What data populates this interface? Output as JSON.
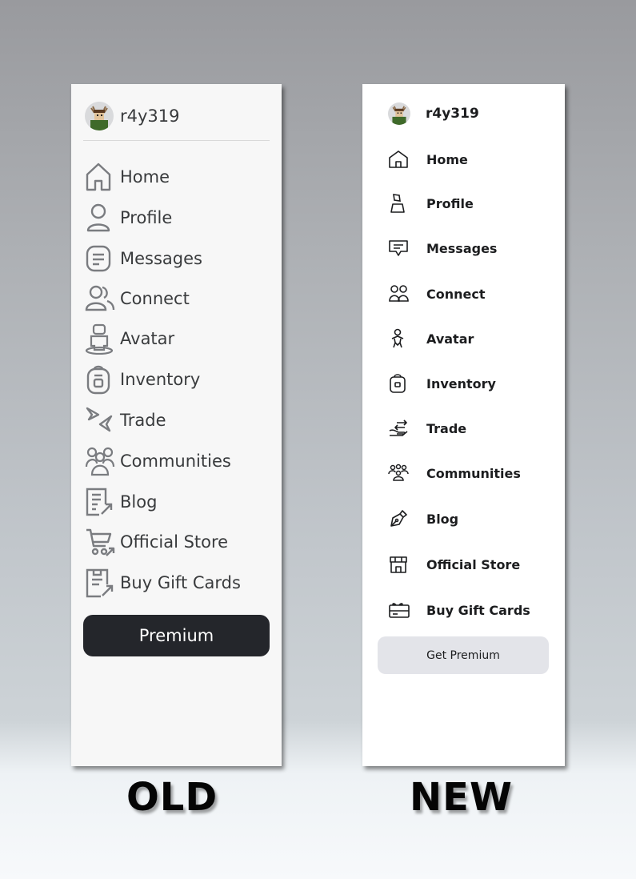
{
  "old_panel": {
    "username": "r4y319",
    "items": [
      {
        "label": "Home",
        "icon": "home-icon"
      },
      {
        "label": "Profile",
        "icon": "profile-icon"
      },
      {
        "label": "Messages",
        "icon": "messages-icon"
      },
      {
        "label": "Connect",
        "icon": "connect-icon"
      },
      {
        "label": "Avatar",
        "icon": "avatar-icon"
      },
      {
        "label": "Inventory",
        "icon": "inventory-icon"
      },
      {
        "label": "Trade",
        "icon": "trade-icon"
      },
      {
        "label": "Communities",
        "icon": "communities-icon"
      },
      {
        "label": "Blog",
        "icon": "blog-icon"
      },
      {
        "label": "Official Store",
        "icon": "store-icon"
      },
      {
        "label": "Buy Gift Cards",
        "icon": "gift-card-icon"
      }
    ],
    "premium_label": "Premium",
    "button_color": "#24262b"
  },
  "new_panel": {
    "username": "r4y319",
    "items": [
      {
        "label": "Home",
        "icon": "home-icon"
      },
      {
        "label": "Profile",
        "icon": "profile-icon"
      },
      {
        "label": "Messages",
        "icon": "messages-icon"
      },
      {
        "label": "Connect",
        "icon": "connect-icon"
      },
      {
        "label": "Avatar",
        "icon": "avatar-icon"
      },
      {
        "label": "Inventory",
        "icon": "inventory-icon"
      },
      {
        "label": "Trade",
        "icon": "trade-icon"
      },
      {
        "label": "Communities",
        "icon": "communities-icon"
      },
      {
        "label": "Blog",
        "icon": "blog-icon"
      },
      {
        "label": "Official Store",
        "icon": "store-icon"
      },
      {
        "label": "Buy Gift Cards",
        "icon": "gift-card-icon"
      }
    ],
    "premium_label": "Get Premium",
    "button_color": "#e3e4e9"
  },
  "captions": {
    "old": "OLD",
    "new": "NEW"
  }
}
